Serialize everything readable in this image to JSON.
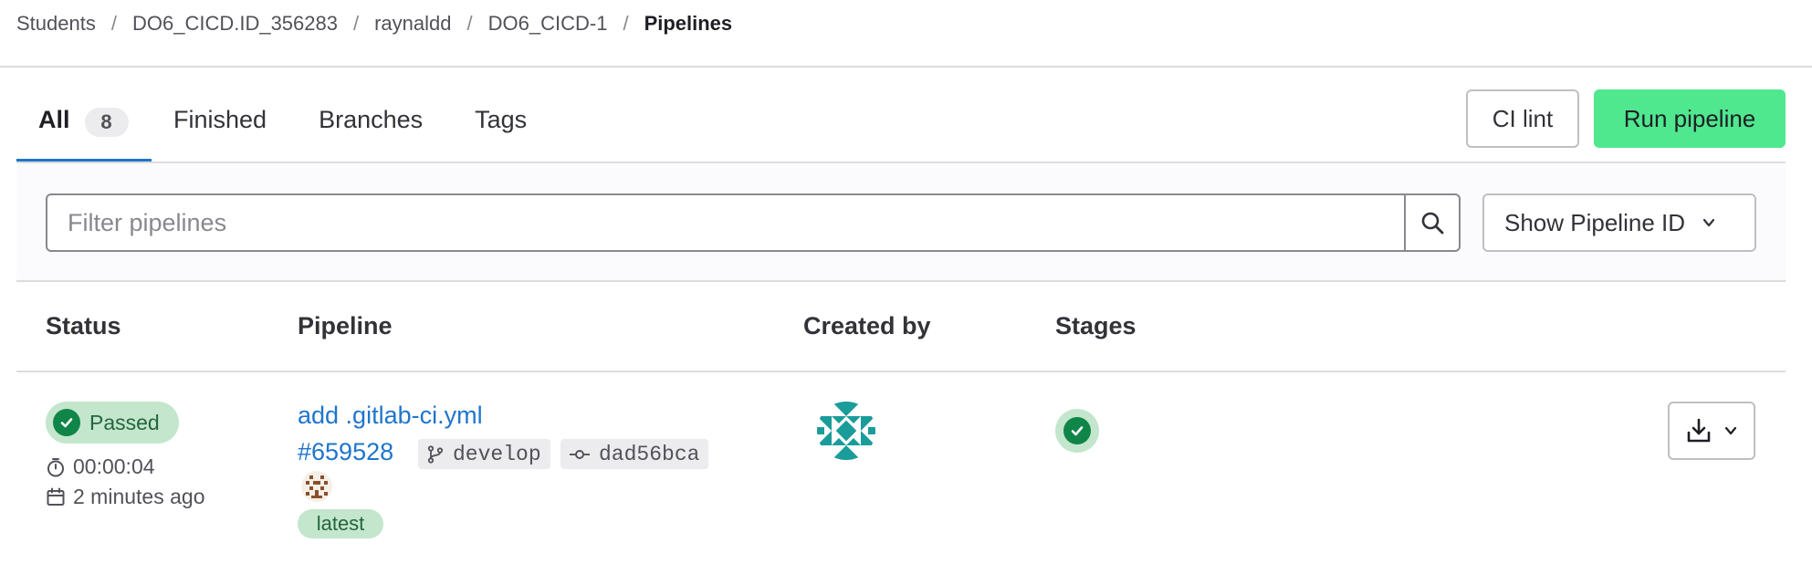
{
  "breadcrumb": {
    "items": [
      "Students",
      "DO6_CICD.ID_356283",
      "raynaldd",
      "DO6_CICD-1",
      "Pipelines"
    ],
    "separator": "/"
  },
  "tabs": {
    "all": {
      "label": "All",
      "count": "8"
    },
    "finished": {
      "label": "Finished"
    },
    "branches": {
      "label": "Branches"
    },
    "tags": {
      "label": "Tags"
    }
  },
  "actions": {
    "ci_lint": "CI lint",
    "run_pipeline": "Run pipeline"
  },
  "filter": {
    "placeholder": "Filter pipelines",
    "value": "",
    "show_id_label": "Show Pipeline ID"
  },
  "table": {
    "headers": {
      "status": "Status",
      "pipeline": "Pipeline",
      "created_by": "Created by",
      "stages": "Stages"
    },
    "rows": [
      {
        "status": "Passed",
        "duration": "00:00:04",
        "finished": "2 minutes ago",
        "commit_title": "add .gitlab-ci.yml",
        "pipeline_id": "#659528",
        "branch": "develop",
        "commit_sha": "dad56bca",
        "tag": "latest",
        "stage_status": "passed"
      }
    ]
  },
  "icons": {
    "status": "check-circle-icon",
    "duration": "timer-icon",
    "finished": "calendar-icon",
    "branch": "branch-icon",
    "commit": "commit-icon",
    "search": "search-icon",
    "download": "download-icon",
    "dropdown": "chevron-down-icon"
  },
  "colors": {
    "primary_link": "#1f75cb",
    "run_button": "#4fe88f",
    "success": "#108548",
    "success_bg": "#c3e6cd",
    "tab_underline": "#1f75cb"
  }
}
